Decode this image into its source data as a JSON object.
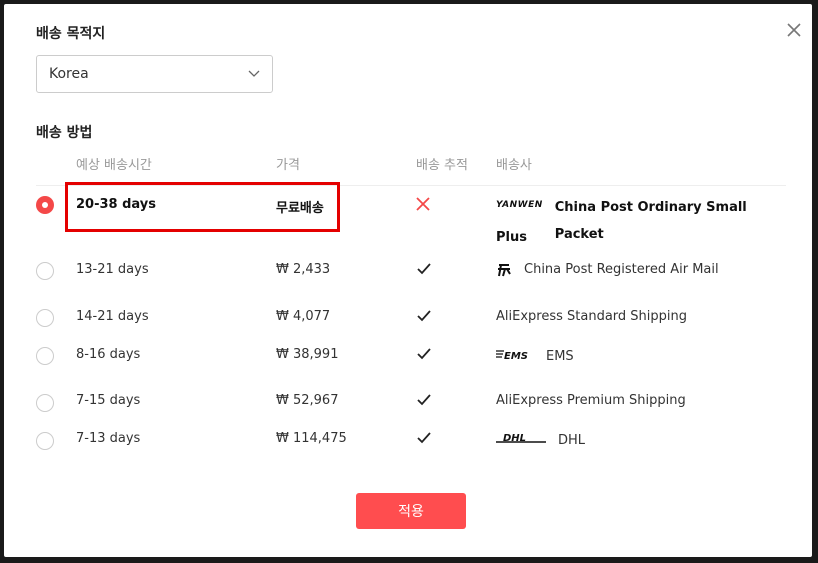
{
  "modal": {
    "destination_title": "배송 목적지",
    "country_value": "Korea",
    "method_title": "배송 방법",
    "apply_label": "적용"
  },
  "columns": {
    "time": "예상 배송시간",
    "price": "가격",
    "tracking": "배송 추적",
    "carrier": "배송사"
  },
  "options": [
    {
      "time": "20-38 days",
      "price": "무료배송",
      "tracking": "none",
      "carrier_line1": "China Post Ordinary Small Packet",
      "carrier_line2": "Plus",
      "logo": "YANWEN",
      "selected": true
    },
    {
      "time": "13-21 days",
      "price": "₩ 2,433",
      "tracking": "check",
      "carrier_line1": "China Post Registered Air Mail",
      "logo": "china-post-icon",
      "selected": false
    },
    {
      "time": "14-21 days",
      "price": "₩ 4,077",
      "tracking": "check",
      "carrier_line1": "AliExpress Standard Shipping",
      "selected": false
    },
    {
      "time": "8-16 days",
      "price": "₩ 38,991",
      "tracking": "check",
      "carrier_line1": "EMS",
      "logo": "EMS",
      "selected": false
    },
    {
      "time": "7-15 days",
      "price": "₩ 52,967",
      "tracking": "check",
      "carrier_line1": "AliExpress Premium Shipping",
      "selected": false
    },
    {
      "time": "7-13 days",
      "price": "₩ 114,475",
      "tracking": "check",
      "carrier_line1": "DHL",
      "logo": "DHL",
      "selected": false
    }
  ],
  "colors": {
    "accent": "#ff4d4f",
    "highlight": "#e40000",
    "cross": "#f44848"
  }
}
